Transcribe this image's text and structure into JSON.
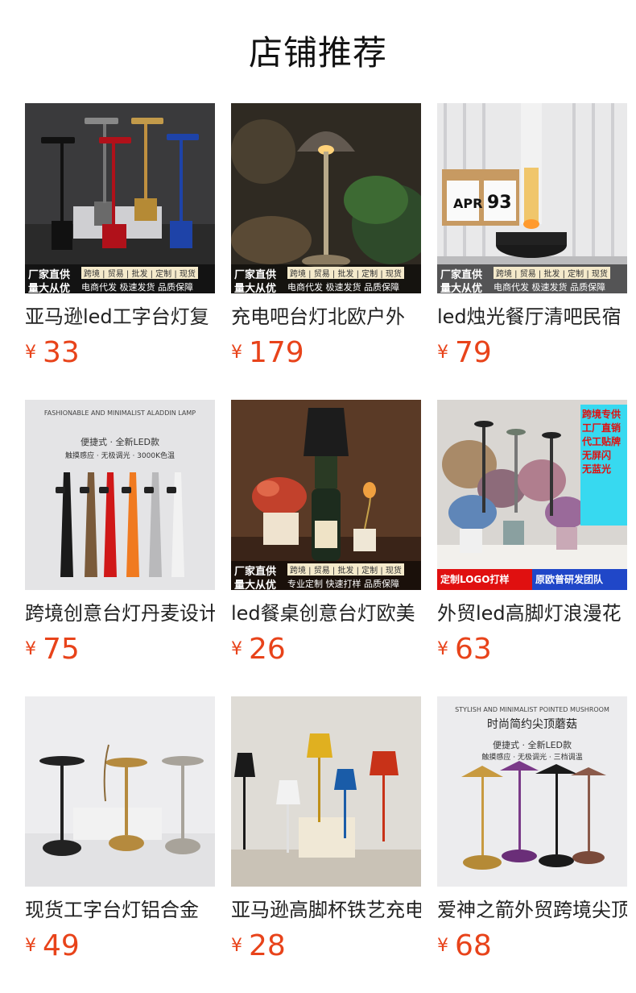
{
  "page": {
    "title": "店铺推荐"
  },
  "products": [
    {
      "name": "亚马逊led工字台灯复",
      "currency": "¥",
      "price": "33",
      "banner": {
        "line1": "厂家直供",
        "line2": "量大从优",
        "tags": "跨境 | 贸易 | 批发 | 定制 | 现货",
        "sub": "电商代发 极速发货 品质保障"
      }
    },
    {
      "name": "充电吧台灯北欧户外",
      "currency": "¥",
      "price": "179",
      "banner": {
        "line1": "厂家直供",
        "line2": "量大从优",
        "tags": "跨境 | 贸易 | 批发 | 定制 | 现货",
        "sub": "电商代发 极速发货 品质保障"
      }
    },
    {
      "name": "led烛光餐厅清吧民宿",
      "currency": "¥",
      "price": "79",
      "banner": {
        "line1": "厂家直供",
        "line2": "量大从优",
        "tags": "跨境 | 贸易 | 批发 | 定制 | 现货",
        "sub": "电商代发 极速发货 品质保障"
      }
    },
    {
      "name": "跨境创意台灯丹麦设计",
      "currency": "¥",
      "price": "75",
      "caption": {
        "top": "FASHIONABLE AND MINIMALIST ALADDIN LAMP",
        "sub": "便捷式 · 全新LED款",
        "sub2": "触摸感应 · 无极调光 · 3000K色温"
      }
    },
    {
      "name": "led餐桌创意台灯欧美",
      "currency": "¥",
      "price": "26",
      "banner": {
        "line1": "厂家直供",
        "line2": "量大从优",
        "tags": "跨境 | 贸易 | 批发 | 定制 | 现货",
        "sub": "专业定制 快速打样 品质保障"
      }
    },
    {
      "name": "外贸led高脚灯浪漫花",
      "currency": "¥",
      "price": "63",
      "side": [
        "跨境专供",
        "工厂直销",
        "代工贴牌",
        "无屏闪",
        "无蓝光"
      ],
      "bar": {
        "left": "定制LOGO打样",
        "right": "原欧普研发团队"
      }
    },
    {
      "name": "现货工字台灯铝合金",
      "currency": "¥",
      "price": "49"
    },
    {
      "name": "亚马逊高脚杯铁艺充电",
      "currency": "¥",
      "price": "28"
    },
    {
      "name": "爱神之箭外贸跨境尖顶",
      "currency": "¥",
      "price": "68",
      "caption": {
        "top": "STYLISH AND MINIMALIST POINTED MUSHROOM",
        "big": "时尚简约尖顶蘑菇",
        "sub": "便捷式 · 全新LED款",
        "sub2": "触摸感应 · 无极调光 · 三档调温"
      }
    }
  ],
  "colors": {
    "price": "#e8431a",
    "text": "#222222",
    "background": "#ffffff"
  }
}
